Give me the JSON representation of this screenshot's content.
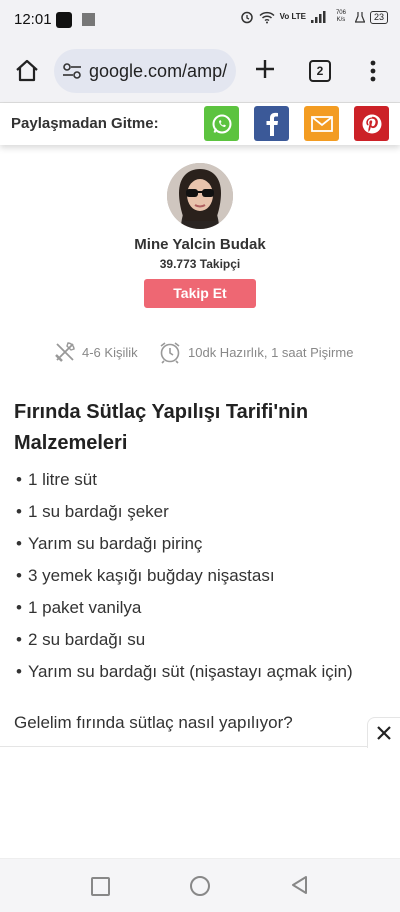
{
  "status": {
    "time": "12:01",
    "network": "Vo LTE",
    "speed": "706 K/s",
    "battery": "23"
  },
  "browser": {
    "url": "google.com/amp/",
    "tab_count": "2"
  },
  "share": {
    "label": "Paylaşmadan Gitme:",
    "buttons": [
      "whatsapp-icon",
      "facebook-icon",
      "mail-icon",
      "pinterest-icon"
    ],
    "colors": {
      "whatsapp": "#5cc33f",
      "facebook": "#3b5998",
      "mail": "#f39c22",
      "pinterest": "#cc2127"
    }
  },
  "author": {
    "name": "Mine Yalcin Budak",
    "followers": "39.773 Takipçi",
    "follow_label": "Takip Et",
    "follow_color": "#ee6773"
  },
  "meta": {
    "servings": "4-6 Kişilik",
    "time": "10dk Hazırlık, 1 saat Pişirme"
  },
  "recipe": {
    "title": "Fırında Sütlaç Yapılışı Tarifi'nin Malzemeleri",
    "ingredients": [
      "1 litre süt",
      "1 su bardağı şeker",
      "Yarım su bardağı pirinç",
      "3 yemek kaşığı buğday nişastası",
      "1 paket vanilya",
      "2 su bardağı su",
      "Yarım su bardağı süt (nişastayı açmak için)"
    ],
    "intro": "Gelelim fırında sütlaç nasıl yapılıyor?"
  }
}
